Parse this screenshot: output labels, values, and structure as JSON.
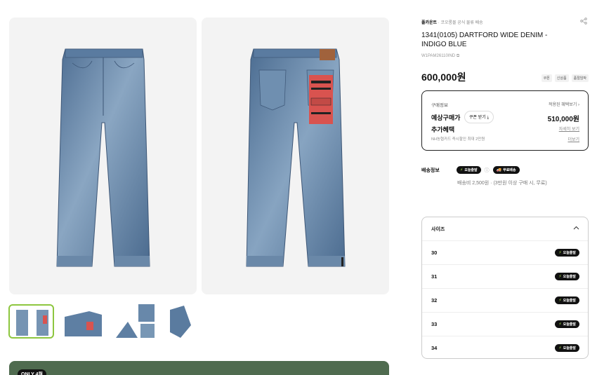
{
  "brand": {
    "name": "폴카운트",
    "note": "코오롱몰 공식 물류 배송"
  },
  "product": {
    "title": "1341(0105) DARTFORD WIDE DENIM - INDIGO BLUE",
    "code": "W1PAM26110IND",
    "price": "600,000원",
    "tags": [
      "쿠폰",
      "신상품",
      "품절임박"
    ]
  },
  "buy": {
    "label": "구매정보",
    "benefit_link": "적용된 혜택보기 ›",
    "est_label": "예상구매가",
    "coupon_label": "쿠폰 받기 ⤓",
    "est_price": "510,000원",
    "extra_label": "추가혜택",
    "detail_link": "자세히 보기",
    "card_note": "NH농협카드 즉시할인 최대 2만원",
    "more_link": "더보기"
  },
  "shipping": {
    "label": "배송정보",
    "badge_today": "오늘출발",
    "badge_free": "무료배송",
    "fee": "배송비 2,500원 · (3만원 이상 구매 시, 무료)"
  },
  "sizes": {
    "header": "사이즈",
    "badge": "오늘출발",
    "items": [
      {
        "value": "30"
      },
      {
        "value": "31"
      },
      {
        "value": "32"
      },
      {
        "value": "33"
      },
      {
        "value": "34"
      }
    ]
  },
  "promo": {
    "tag": "ONLY 4월"
  },
  "icons": {
    "share": "share-icon",
    "chevron": "chevron-up-icon",
    "info": "info-icon"
  },
  "colors": {
    "accent_green": "#8dc63f",
    "promo_bg": "#4f6b4f",
    "badge_bg": "#111111",
    "label_red": "#d9534f"
  }
}
